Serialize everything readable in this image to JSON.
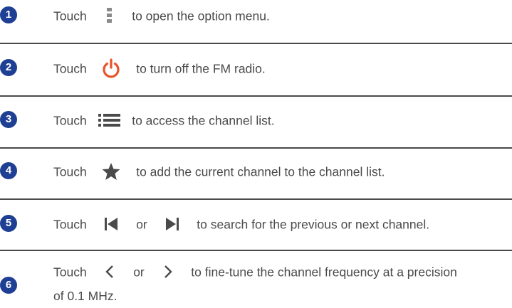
{
  "steps": [
    {
      "number": "1",
      "parts": [
        "Touch",
        "to open the option menu."
      ],
      "icons": [
        "overflow-menu-icon"
      ]
    },
    {
      "number": "2",
      "parts": [
        "Touch",
        "to turn off the FM radio."
      ],
      "icons": [
        "power-icon"
      ]
    },
    {
      "number": "3",
      "parts": [
        "Touch",
        "to access the channel list."
      ],
      "icons": [
        "channel-list-icon"
      ]
    },
    {
      "number": "4",
      "parts": [
        "Touch",
        "to add the current channel to the channel list."
      ],
      "icons": [
        "star-icon"
      ]
    },
    {
      "number": "5",
      "parts": [
        "Touch",
        "or",
        "to search for the previous or next channel."
      ],
      "icons": [
        "previous-channel-icon",
        "next-channel-icon"
      ]
    },
    {
      "number": "6",
      "parts": [
        "Touch",
        "or",
        "to fine-tune the channel frequency at a precision",
        "of 0.1 MHz."
      ],
      "icons": [
        "chevron-left-icon",
        "chevron-right-icon"
      ]
    }
  ],
  "colors": {
    "number_badge": "#1f3f94",
    "power_icon": "#e8542a",
    "text": "#4a4a4a"
  }
}
